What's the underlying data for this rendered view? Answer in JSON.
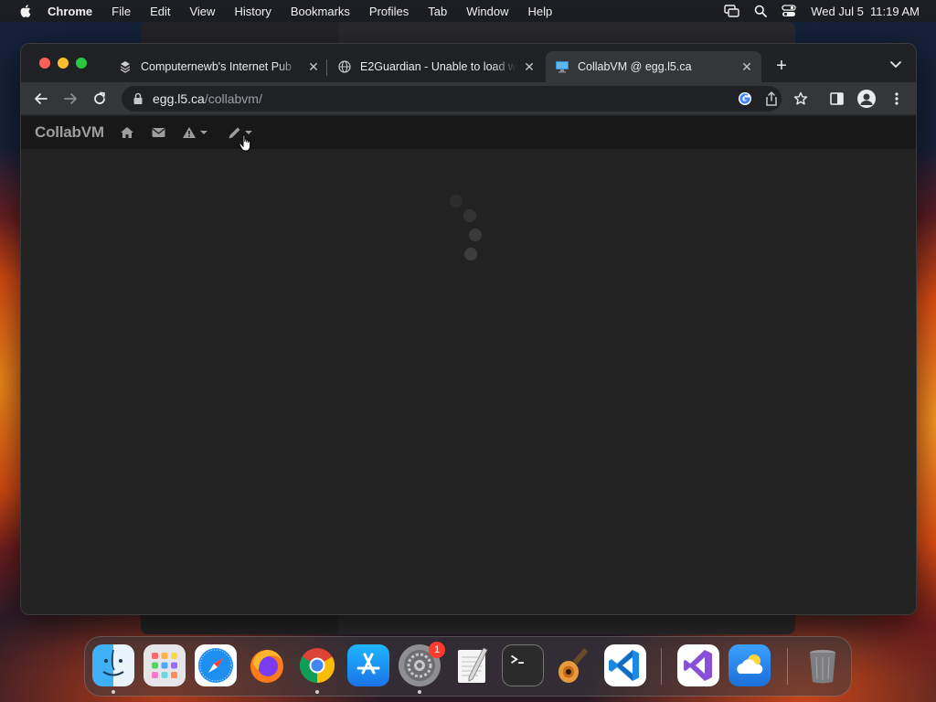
{
  "menubar": {
    "app_name": "Chrome",
    "items": [
      "File",
      "Edit",
      "View",
      "History",
      "Bookmarks",
      "Profiles",
      "Tab",
      "Window",
      "Help"
    ],
    "clock": "Wed Jul 5  11:19 AM"
  },
  "tabs": [
    {
      "title": "Computernewb's Internet Pub",
      "icon": "computernewb-favicon",
      "active": false
    },
    {
      "title": "E2Guardian - Unable to load w",
      "icon": "globe-icon",
      "active": false
    },
    {
      "title": "CollabVM @ egg.l5.ca",
      "icon": "collabvm-favicon",
      "active": true
    }
  ],
  "address_bar": {
    "host": "egg.l5.ca",
    "path": "/collabvm/"
  },
  "page": {
    "brand": "CollabVM",
    "nav_icons": [
      "home-icon",
      "envelope-icon",
      "warning-icon",
      "pen-icon"
    ]
  },
  "dock": {
    "apps": [
      "Finder",
      "Launchpad",
      "Safari",
      "Firefox",
      "Google Chrome",
      "App Store",
      "System Settings",
      "TextEdit",
      "Terminal",
      "GarageBand",
      "Visual Studio Code",
      "Visual Studio",
      "Weather",
      "Trash"
    ],
    "system_settings_badge": "1"
  },
  "colors": {
    "chrome_frame": "#202124",
    "toolbar": "#35363a",
    "page_bg": "#222222",
    "navbar_bg": "#181818",
    "brand_text": "#9d9d9d"
  }
}
